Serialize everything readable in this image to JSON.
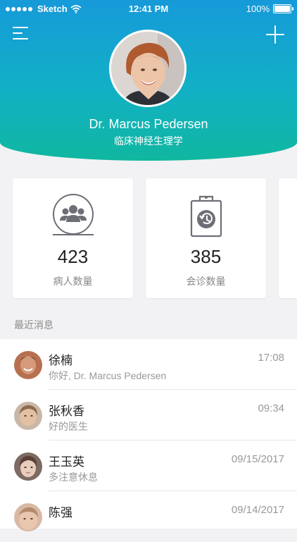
{
  "status_bar": {
    "carrier": "Sketch",
    "time": "12:41 PM",
    "battery": "100%"
  },
  "profile": {
    "name": "Dr. Marcus Pedersen",
    "department": "临床神经生理学"
  },
  "stats": [
    {
      "icon": "patients-icon",
      "value": "423",
      "label": "病人数量"
    },
    {
      "icon": "consultation-clipboard-icon",
      "value": "385",
      "label": "会诊数量"
    }
  ],
  "section": {
    "recent_messages": "最近消息"
  },
  "messages": [
    {
      "name": "徐楠",
      "preview": "你好, Dr. Marcus Pedersen",
      "time": "17:08"
    },
    {
      "name": "张秋香",
      "preview": "好的医生",
      "time": "09:34"
    },
    {
      "name": "王玉英",
      "preview": "多注意休息",
      "time": "09/15/2017"
    },
    {
      "name": "陈强",
      "preview": "",
      "time": "09/14/2017"
    }
  ],
  "colors": {
    "header_top": "#169ad9",
    "header_bottom": "#10b79f",
    "icon_gray": "#6e6e76"
  }
}
